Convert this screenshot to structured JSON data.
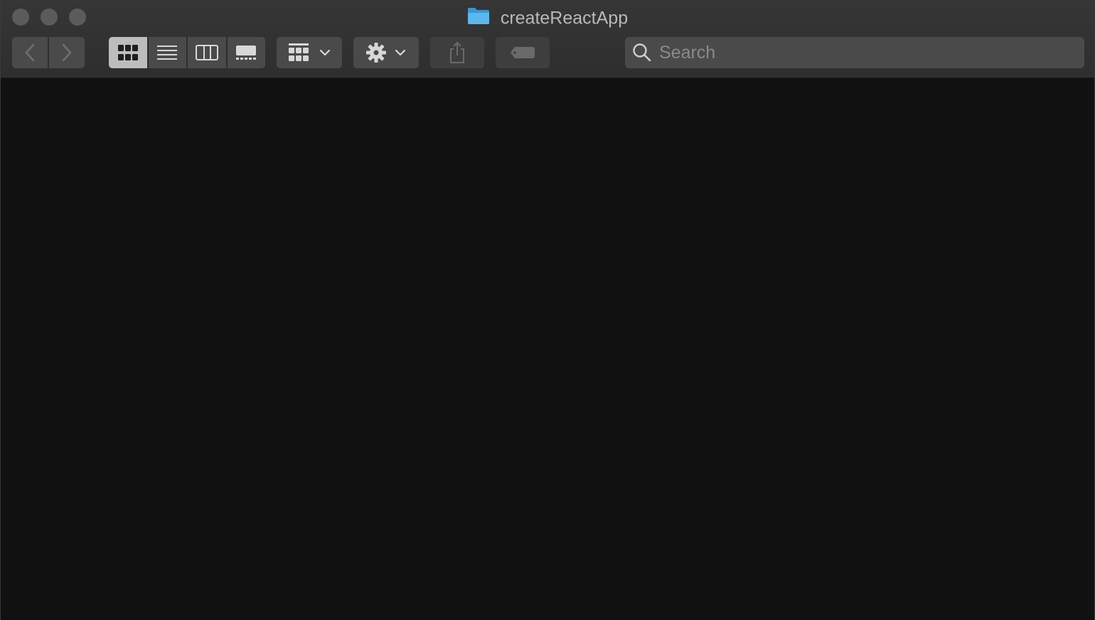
{
  "window": {
    "title": "createReactApp",
    "title_icon": "folder-icon",
    "folder_color": "#4aa6e0"
  },
  "toolbar": {
    "back_icon": "chevron-left-icon",
    "forward_icon": "chevron-right-icon",
    "view_modes": [
      "icon-view",
      "list-view",
      "column-view",
      "gallery-view"
    ],
    "active_view": "icon-view",
    "group_icon": "group-grid-icon",
    "action_icon": "gear-icon",
    "share_icon": "share-icon",
    "tag_icon": "tag-icon"
  },
  "search": {
    "placeholder": "Search",
    "value": ""
  },
  "colors": {
    "titlebar": "#333333",
    "content_background": "#111111",
    "control": "#4a4a4a",
    "active_segment": "#bdbdbd"
  }
}
